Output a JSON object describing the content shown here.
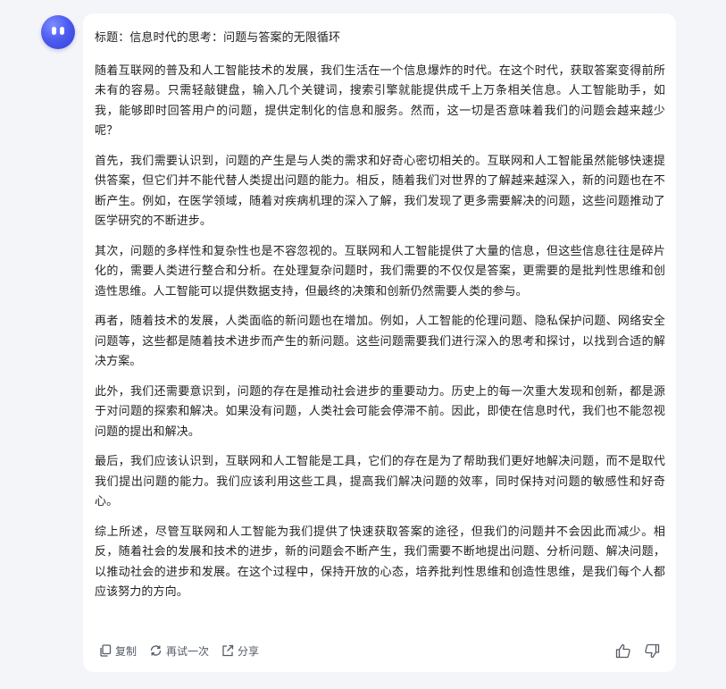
{
  "message": {
    "title": "标题：信息时代的思考：问题与答案的无限循环",
    "paragraphs": [
      "随着互联网的普及和人工智能技术的发展，我们生活在一个信息爆炸的时代。在这个时代，获取答案变得前所未有的容易。只需轻敲键盘，输入几个关键词，搜索引擎就能提供成千上万条相关信息。人工智能助手，如我，能够即时回答用户的问题，提供定制化的信息和服务。然而，这一切是否意味着我们的问题会越来越少呢？",
      "首先，我们需要认识到，问题的产生是与人类的需求和好奇心密切相关的。互联网和人工智能虽然能够快速提供答案，但它们并不能代替人类提出问题的能力。相反，随着我们对世界的了解越来越深入，新的问题也在不断产生。例如，在医学领域，随着对疾病机理的深入了解，我们发现了更多需要解决的问题，这些问题推动了医学研究的不断进步。",
      "其次，问题的多样性和复杂性也是不容忽视的。互联网和人工智能提供了大量的信息，但这些信息往往是碎片化的，需要人类进行整合和分析。在处理复杂问题时，我们需要的不仅仅是答案，更需要的是批判性思维和创造性思维。人工智能可以提供数据支持，但最终的决策和创新仍然需要人类的参与。",
      "再者，随着技术的发展，人类面临的新问题也在增加。例如，人工智能的伦理问题、隐私保护问题、网络安全问题等，这些都是随着技术进步而产生的新问题。这些问题需要我们进行深入的思考和探讨，以找到合适的解决方案。",
      "此外，我们还需要意识到，问题的存在是推动社会进步的重要动力。历史上的每一次重大发现和创新，都是源于对问题的探索和解决。如果没有问题，人类社会可能会停滞不前。因此，即使在信息时代，我们也不能忽视问题的提出和解决。",
      "最后，我们应该认识到，互联网和人工智能是工具，它们的存在是为了帮助我们更好地解决问题，而不是取代我们提出问题的能力。我们应该利用这些工具，提高我们解决问题的效率，同时保持对问题的敏感性和好奇心。",
      "综上所述，尽管互联网和人工智能为我们提供了快速获取答案的途径，但我们的问题并不会因此而减少。相反，随着社会的发展和技术的进步，新的问题会不断产生，我们需要不断地提出问题、分析问题、解决问题，以推动社会的进步和发展。在这个过程中，保持开放的心态，培养批判性思维和创造性思维，是我们每个人都应该努力的方向。"
    ]
  },
  "actions": {
    "copy_label": "复制",
    "retry_label": "再试一次",
    "share_label": "分享",
    "copy_icon": "copy-icon",
    "retry_icon": "refresh-icon",
    "share_icon": "share-icon",
    "like_icon": "thumbs-up-icon",
    "dislike_icon": "thumbs-down-icon"
  },
  "colors": {
    "avatar": "#4e5cf0",
    "background": "#f4f5f8",
    "text": "#222222",
    "action_text": "#555b66"
  }
}
